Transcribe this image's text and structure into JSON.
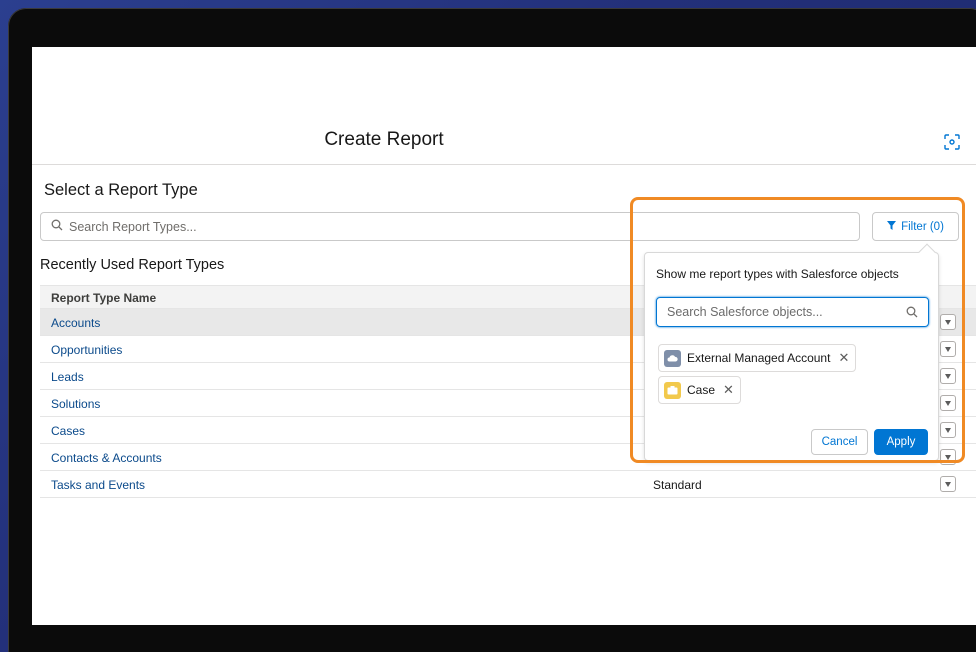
{
  "header": {
    "title": "Create Report"
  },
  "section_title": "Select a Report Type",
  "search": {
    "placeholder": "Search Report Types..."
  },
  "filter_button": {
    "label": "Filter (0)"
  },
  "recent_title": "Recently Used Report Types",
  "table": {
    "column_header": "Report Type Name",
    "rows": [
      {
        "name": "Accounts",
        "category": ""
      },
      {
        "name": "Opportunities",
        "category": ""
      },
      {
        "name": "Leads",
        "category": ""
      },
      {
        "name": "Solutions",
        "category": ""
      },
      {
        "name": "Cases",
        "category": ""
      },
      {
        "name": "Contacts & Accounts",
        "category": ""
      },
      {
        "name": "Tasks and Events",
        "category": "Standard"
      }
    ]
  },
  "filter_popover": {
    "heading": "Show me report types with Salesforce objects",
    "search_placeholder": "Search Salesforce objects...",
    "selected_objects": [
      {
        "label": "External Managed Account",
        "icon": "cloud-object-icon",
        "color": "#7f8fa9"
      },
      {
        "label": "Case",
        "icon": "case-icon",
        "color": "#f2c94c"
      }
    ],
    "cancel_label": "Cancel",
    "apply_label": "Apply"
  },
  "colors": {
    "accent": "#0176d3",
    "highlight_frame": "#f08a24",
    "link": "#0b4a8b"
  }
}
